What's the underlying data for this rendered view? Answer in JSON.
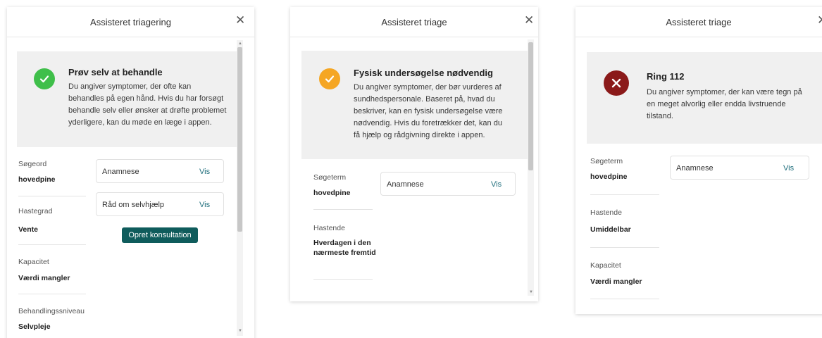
{
  "colors": {
    "self_care": "#3fbf4a",
    "examination": "#f5a623",
    "emergency": "#8b1a1a",
    "primary_button": "#0f5c5c",
    "link": "#1f6e7c"
  },
  "panel1": {
    "title": "Assisteret triagering",
    "close_icon": "close-icon",
    "result": {
      "icon": "checkmark-icon",
      "heading": "Prøv selv at behandle",
      "text": "Du angiver symptomer, der ofte kan behandles på egen hånd. Hvis du har forsøgt behandle selv eller ønsker at drøfte problemet yderligere, kan du møde en læge i appen."
    },
    "fields": [
      {
        "label": "Søgeord",
        "value": "hovedpine"
      },
      {
        "label": "Hastegrad",
        "value": "Vente"
      },
      {
        "label": "Kapacitet",
        "value": "Værdi mangler"
      },
      {
        "label": "Behandlingssniveau",
        "value": "Selvpleje"
      }
    ],
    "cards": [
      {
        "label": "Anamnese",
        "action": "Vis"
      },
      {
        "label": "Råd om selvhjælp",
        "action": "Vis"
      }
    ],
    "button_label": "Opret konsultation"
  },
  "panel2": {
    "title": "Assisteret triage",
    "close_icon": "close-icon",
    "result": {
      "icon": "checkmark-icon",
      "heading": "Fysisk undersøgelse nødvendig",
      "text": "Du angiver symptomer, der bør vurderes af sundhedspersonale. Baseret på, hvad du beskriver, kan en fysisk undersøgelse være nødvendig. Hvis du foretrækker det, kan du få hjælp og rådgivning direkte i appen."
    },
    "fields": [
      {
        "label": "Søgeterm",
        "value": "hovedpine"
      },
      {
        "label": "Hastende",
        "value": "Hverdagen i den nærmeste fremtid"
      }
    ],
    "cards": [
      {
        "label": "Anamnese",
        "action": "Vis"
      }
    ]
  },
  "panel3": {
    "title": "Assisteret triage",
    "close_icon": "close-icon",
    "result": {
      "icon": "x-icon",
      "heading": "Ring 112",
      "text": "Du angiver symptomer, der kan være tegn på en meget alvorlig eller endda livstruende tilstand."
    },
    "fields": [
      {
        "label": "Søgeterm",
        "value": "hovedpine"
      },
      {
        "label": "Hastende",
        "value": "Umiddelbar"
      },
      {
        "label": "Kapacitet",
        "value": "Værdi mangler"
      }
    ],
    "cards": [
      {
        "label": "Anamnese",
        "action": "Vis"
      }
    ]
  }
}
